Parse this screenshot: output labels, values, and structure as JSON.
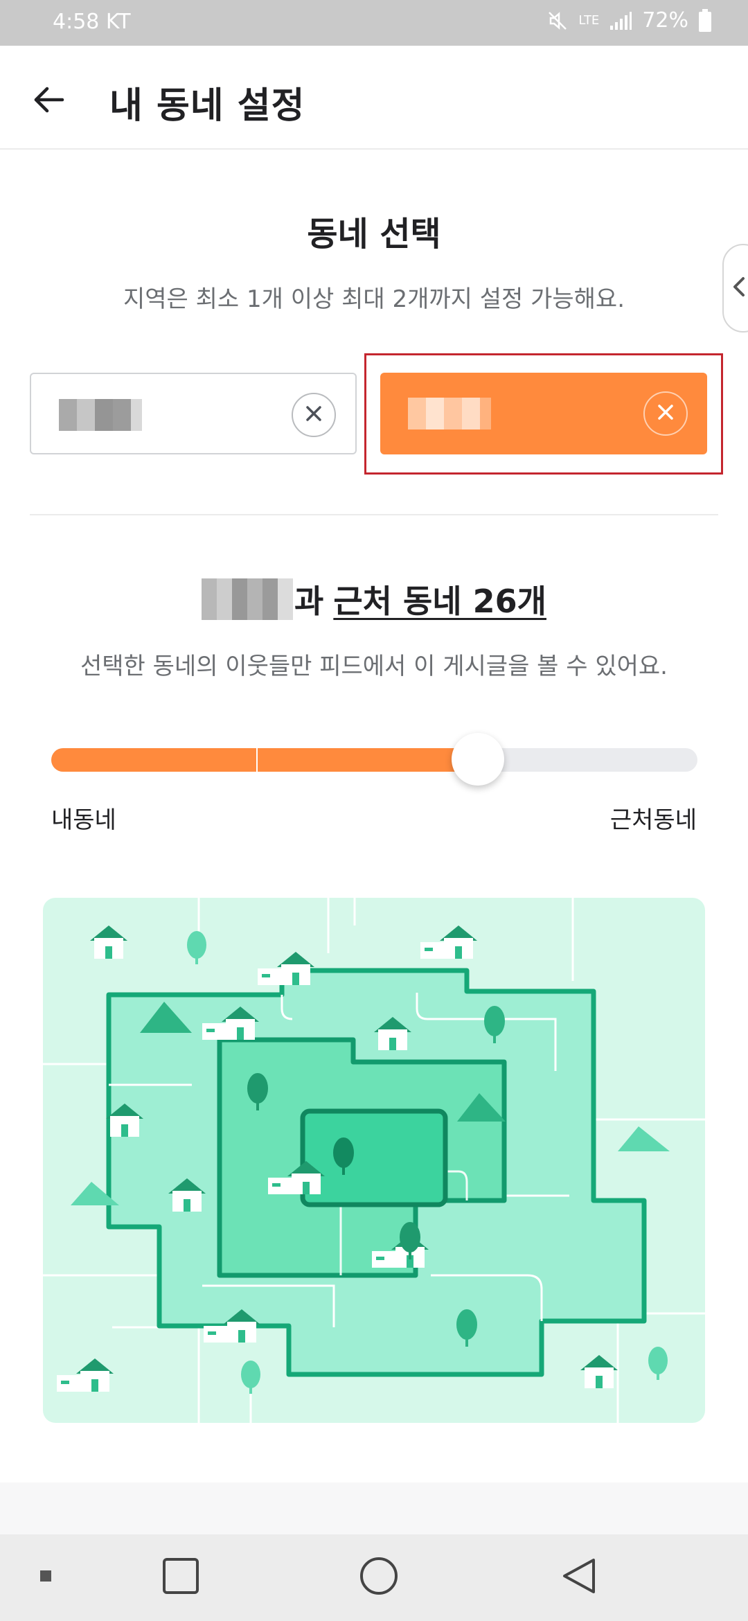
{
  "status_bar": {
    "time": "4:58 KT",
    "network": "LTE",
    "battery": "72%"
  },
  "header": {
    "title": "내 동네 설정"
  },
  "town_select": {
    "title": "동네 선택",
    "description": "지역은 최소 1개 이상 최대 2개까지 설정 가능해요."
  },
  "range": {
    "title_suffix": "과",
    "link_text": "근처 동네 26개",
    "description": "선택한 동네의 이웃들만 피드에서 이 게시글을 볼 수 있어요.",
    "slider_level": 0.66,
    "label_left": "내동네",
    "label_right": "근처동네"
  },
  "icons": {
    "back": "arrow-left-icon",
    "clear": "close-icon",
    "drawer": "chevron-left-icon",
    "mute": "mute-icon",
    "signal": "signal-icon",
    "battery": "battery-icon",
    "nav_recents": "square-icon",
    "nav_home": "circle-icon",
    "nav_back": "triangle-back-icon"
  },
  "colors": {
    "accent": "#ff8a3d",
    "highlight_border": "#c4262e",
    "map_bg": "#d6f8ea",
    "map_stroke": "#1a9c72"
  }
}
